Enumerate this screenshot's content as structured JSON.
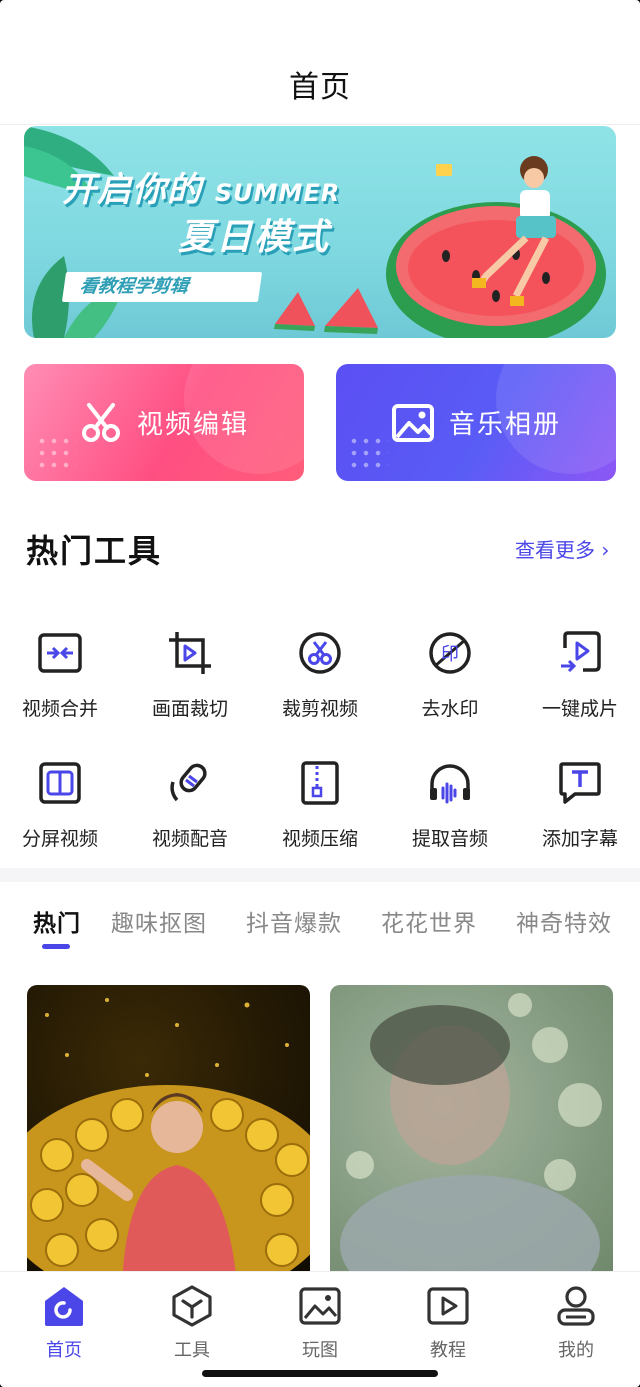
{
  "header": {
    "title": "首页"
  },
  "banner": {
    "headline_cn": "开启你的",
    "headline_en": "SUMMER",
    "headline2": "夏日模式",
    "tag": "看教程学剪辑"
  },
  "actions": {
    "video_edit": "视频编辑",
    "music_album": "音乐相册"
  },
  "hot_tools": {
    "title": "热门工具",
    "more": "查看更多 ›",
    "items": [
      {
        "label": "视频合并",
        "icon": "merge-icon"
      },
      {
        "label": "画面裁切",
        "icon": "crop-icon"
      },
      {
        "label": "裁剪视频",
        "icon": "cut-video-icon"
      },
      {
        "label": "去水印",
        "icon": "watermark-icon"
      },
      {
        "label": "一键成片",
        "icon": "one-click-icon"
      },
      {
        "label": "分屏视频",
        "icon": "split-screen-icon"
      },
      {
        "label": "视频配音",
        "icon": "dubbing-icon"
      },
      {
        "label": "视频压缩",
        "icon": "compress-icon"
      },
      {
        "label": "提取音频",
        "icon": "audio-extract-icon"
      },
      {
        "label": "添加字幕",
        "icon": "subtitle-icon"
      }
    ]
  },
  "category_tabs": [
    "热门",
    "趣味抠图",
    "抖音爆款",
    "花花世界",
    "神奇特效"
  ],
  "tabbar": [
    {
      "label": "首页",
      "icon": "home-icon",
      "active": true
    },
    {
      "label": "工具",
      "icon": "box-icon"
    },
    {
      "label": "玩图",
      "icon": "image-icon"
    },
    {
      "label": "教程",
      "icon": "play-icon"
    },
    {
      "label": "我的",
      "icon": "user-icon"
    }
  ],
  "colors": {
    "accent": "#4a46e8",
    "pink": "#ff4f82",
    "purple": "#5b4ff3"
  }
}
